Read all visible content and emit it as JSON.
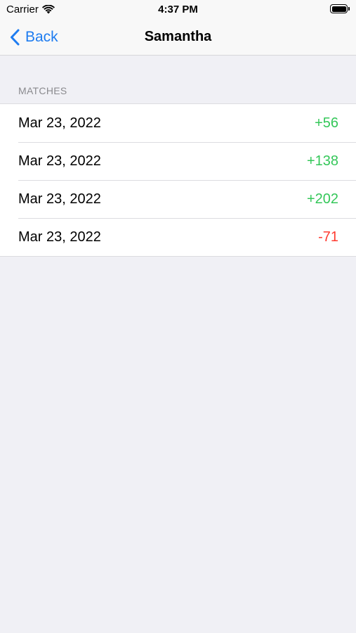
{
  "status_bar": {
    "carrier": "Carrier",
    "time": "4:37 PM"
  },
  "nav": {
    "back_label": "Back",
    "title": "Samantha"
  },
  "section": {
    "header": "MATCHES"
  },
  "matches": [
    {
      "date": "Mar 23, 2022",
      "score": "+56",
      "color": "#34c759"
    },
    {
      "date": "Mar 23, 2022",
      "score": "+138",
      "color": "#34c759"
    },
    {
      "date": "Mar 23, 2022",
      "score": "+202",
      "color": "#34c759"
    },
    {
      "date": "Mar 23, 2022",
      "score": "-71",
      "color": "#ff3b30"
    }
  ],
  "colors": {
    "accent": "#1e7cf0",
    "positive": "#34c759",
    "negative": "#ff3b30"
  },
  "icons": {
    "wifi": "wifi-icon",
    "battery": "battery-icon",
    "back": "chevron-left-icon"
  }
}
